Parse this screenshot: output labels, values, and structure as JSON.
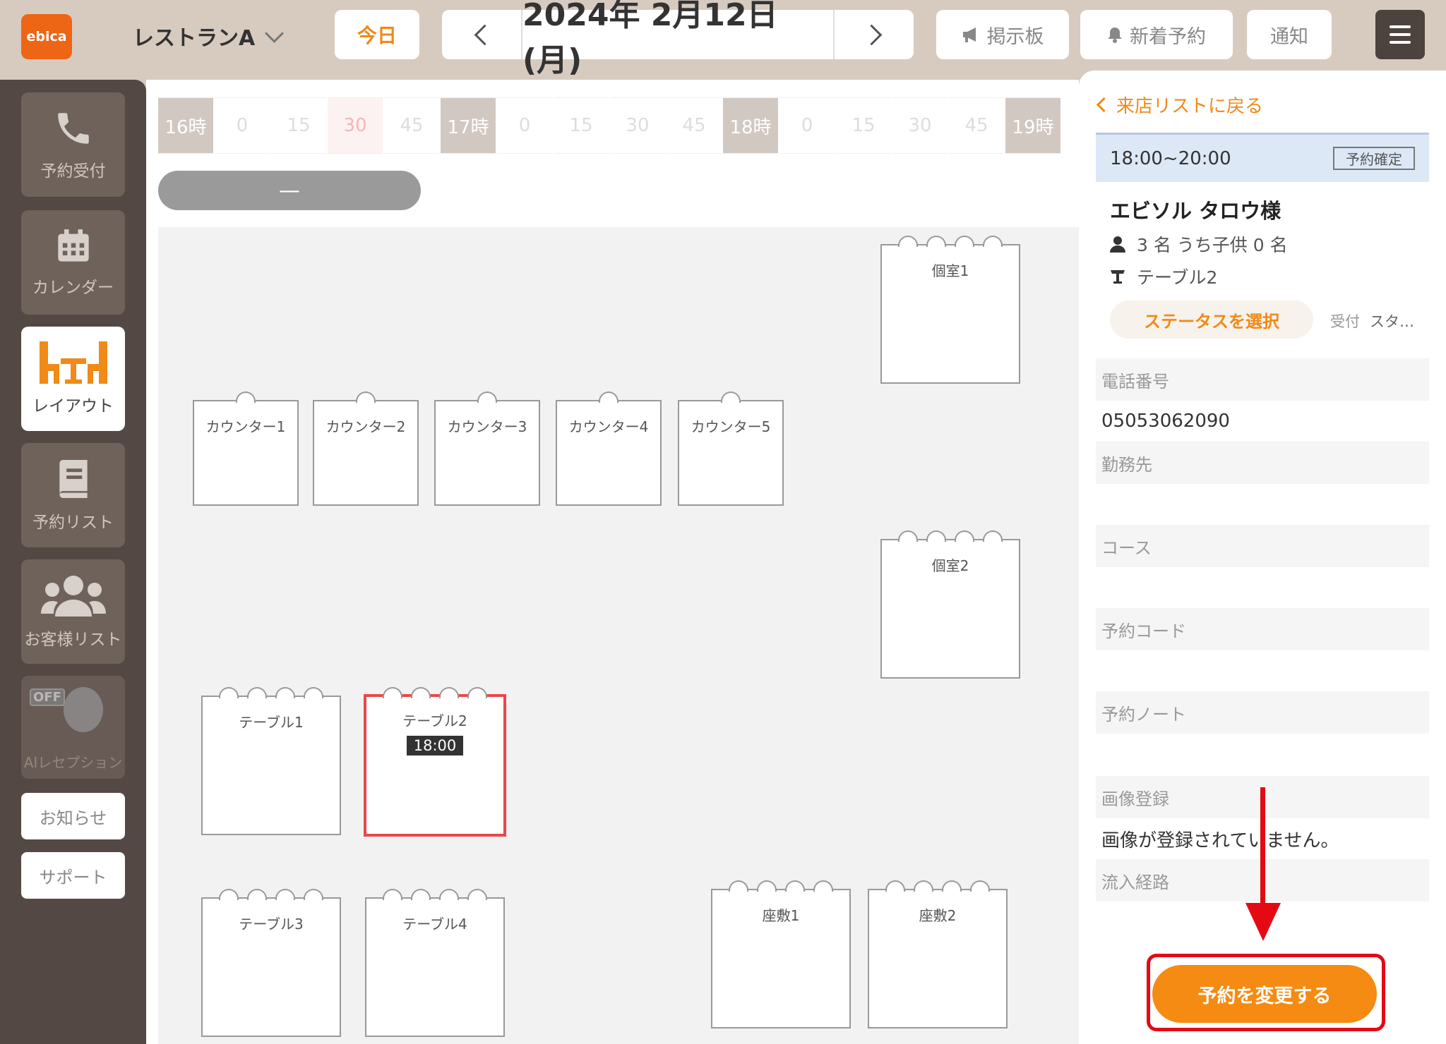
{
  "header": {
    "logo": "ebica",
    "restaurant": "レストランA",
    "today": "今日",
    "date": "2024年 2月12日(月)",
    "bulletin": "掲示板",
    "new_reservations": "新着予約",
    "notifications": "通知"
  },
  "sidebar": {
    "items": [
      {
        "label": "予約受付"
      },
      {
        "label": "カレンダー"
      },
      {
        "label": "レイアウト"
      },
      {
        "label": "予約リスト"
      },
      {
        "label": "お客様リスト"
      }
    ],
    "ai": {
      "label": "AIレセプション",
      "off": "OFF"
    },
    "news": "お知らせ",
    "support": "サポート"
  },
  "timeline": [
    "16時",
    "0",
    "15",
    "30",
    "45",
    "17時",
    "0",
    "15",
    "30",
    "45",
    "18時",
    "0",
    "15",
    "30",
    "45",
    "19時"
  ],
  "filter_pill": "—",
  "seats": [
    {
      "name": "個室1"
    },
    {
      "name": "カウンター1"
    },
    {
      "name": "カウンター2"
    },
    {
      "name": "カウンター3"
    },
    {
      "name": "カウンター4"
    },
    {
      "name": "カウンター5"
    },
    {
      "name": "個室2"
    },
    {
      "name": "テーブル1"
    },
    {
      "name": "テーブル2",
      "time": "18:00"
    },
    {
      "name": "テーブル3"
    },
    {
      "name": "テーブル4"
    },
    {
      "name": "座敷1"
    },
    {
      "name": "座敷2"
    }
  ],
  "panel": {
    "back": "来店リストに戻る",
    "time": "18:00~20:00",
    "status": "予約確定",
    "customer": "エビソル タロウ様",
    "party": "3 名 うち子供 0 名",
    "table": "テーブル2",
    "status_button": "ステータスを選択",
    "reception_label": "受付",
    "reception_value": "スタ…",
    "fields": [
      {
        "label": "電話番号",
        "value": "05053062090"
      },
      {
        "label": "勤務先",
        "value": ""
      },
      {
        "label": "コース",
        "value": ""
      },
      {
        "label": "予約コード",
        "value": ""
      },
      {
        "label": "予約ノート",
        "value": ""
      },
      {
        "label": "画像登録",
        "value": "画像が登録されていません。"
      },
      {
        "label": "流入経路",
        "value": ""
      }
    ],
    "change_button": "予約を変更する"
  },
  "colors": {
    "accent": "#f08a18",
    "highlight": "#e50914",
    "sidebar": "#534843"
  }
}
